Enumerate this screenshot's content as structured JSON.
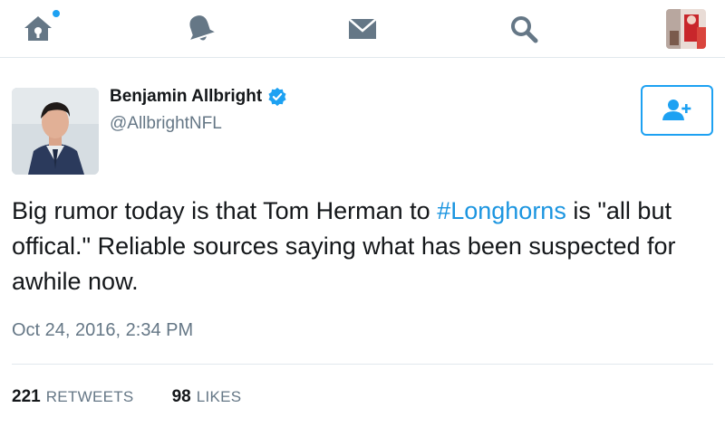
{
  "nav": {
    "items": [
      {
        "name": "home",
        "icon": "home-icon"
      },
      {
        "name": "notifications",
        "icon": "bell-icon"
      },
      {
        "name": "messages",
        "icon": "envelope-icon"
      },
      {
        "name": "search",
        "icon": "search-icon"
      },
      {
        "name": "profile",
        "icon": "avatar"
      }
    ],
    "unread_dot_color": "#1da1f2"
  },
  "tweet": {
    "author": {
      "name": "Benjamin Allbright",
      "handle": "@AllbrightNFL",
      "verified": true
    },
    "text": {
      "before": "Big rumor today is that Tom Herman to ",
      "hashtag": "#Longhorns",
      "after": " is \"all but offical.\"  Reliable sources saying what has been suspected for awhile now."
    },
    "timestamp": "Oct 24, 2016, 2:34 PM",
    "stats": {
      "retweets_count": "221",
      "retweets_label": "RETWEETS",
      "likes_count": "98",
      "likes_label": "LIKES"
    },
    "follow_icon": "add-user-icon"
  },
  "colors": {
    "accent": "#1da1f2",
    "hashtag": "#1b95e0",
    "icon_gray": "#657786",
    "text": "#14171a",
    "muted": "#657786",
    "divider": "#e1e8ed"
  }
}
